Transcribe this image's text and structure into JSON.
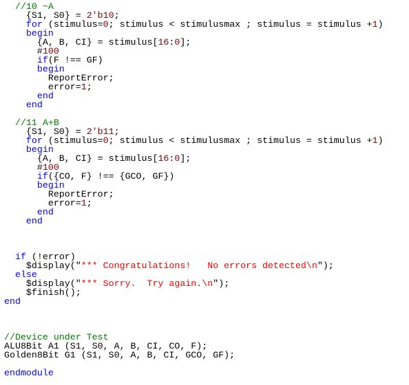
{
  "editor": {
    "language": "verilog",
    "colors": {
      "keyword": "#0000ff",
      "comment": "#008000",
      "number": "#800000",
      "string": "#ff0000",
      "plain": "#000000"
    },
    "lines": [
      {
        "indent": 2,
        "tokens": [
          {
            "t": "cm",
            "v": "//10 ~A"
          }
        ]
      },
      {
        "indent": 4,
        "tokens": [
          {
            "t": "pl",
            "v": "{S1, S0} = "
          },
          {
            "t": "num",
            "v": "2'b10"
          },
          {
            "t": "pl",
            "v": ";"
          }
        ]
      },
      {
        "indent": 4,
        "tokens": [
          {
            "t": "kw",
            "v": "for"
          },
          {
            "t": "pl",
            "v": " (stimulus="
          },
          {
            "t": "num",
            "v": "0"
          },
          {
            "t": "pl",
            "v": "; stimulus < stimulusmax ; stimulus = stimulus +"
          },
          {
            "t": "num",
            "v": "1"
          },
          {
            "t": "pl",
            "v": ")"
          }
        ]
      },
      {
        "indent": 4,
        "tokens": [
          {
            "t": "kw",
            "v": "begin"
          }
        ]
      },
      {
        "indent": 6,
        "tokens": [
          {
            "t": "pl",
            "v": "{A, B, CI} = stimulus["
          },
          {
            "t": "num",
            "v": "16"
          },
          {
            "t": "pl",
            "v": ":"
          },
          {
            "t": "num",
            "v": "0"
          },
          {
            "t": "pl",
            "v": "];"
          }
        ]
      },
      {
        "indent": 6,
        "tokens": [
          {
            "t": "pl",
            "v": "#"
          },
          {
            "t": "num",
            "v": "100"
          }
        ]
      },
      {
        "indent": 6,
        "tokens": [
          {
            "t": "kw",
            "v": "if"
          },
          {
            "t": "pl",
            "v": "(F !== GF)"
          }
        ]
      },
      {
        "indent": 6,
        "tokens": [
          {
            "t": "kw",
            "v": "begin"
          }
        ]
      },
      {
        "indent": 8,
        "tokens": [
          {
            "t": "pl",
            "v": "ReportError;"
          }
        ]
      },
      {
        "indent": 8,
        "tokens": [
          {
            "t": "pl",
            "v": "error="
          },
          {
            "t": "num",
            "v": "1"
          },
          {
            "t": "pl",
            "v": ";"
          }
        ]
      },
      {
        "indent": 6,
        "tokens": [
          {
            "t": "kw",
            "v": "end"
          }
        ]
      },
      {
        "indent": 4,
        "tokens": [
          {
            "t": "kw",
            "v": "end"
          }
        ]
      },
      {
        "indent": 0,
        "tokens": []
      },
      {
        "indent": 2,
        "tokens": [
          {
            "t": "cm",
            "v": "//11 A+B"
          }
        ]
      },
      {
        "indent": 4,
        "tokens": [
          {
            "t": "pl",
            "v": "{S1, S0} = "
          },
          {
            "t": "num",
            "v": "2'b11"
          },
          {
            "t": "pl",
            "v": ";"
          }
        ]
      },
      {
        "indent": 4,
        "tokens": [
          {
            "t": "kw",
            "v": "for"
          },
          {
            "t": "pl",
            "v": " (stimulus="
          },
          {
            "t": "num",
            "v": "0"
          },
          {
            "t": "pl",
            "v": "; stimulus < stimulusmax ; stimulus = stimulus +"
          },
          {
            "t": "num",
            "v": "1"
          },
          {
            "t": "pl",
            "v": ")"
          }
        ]
      },
      {
        "indent": 4,
        "tokens": [
          {
            "t": "kw",
            "v": "begin"
          }
        ]
      },
      {
        "indent": 6,
        "tokens": [
          {
            "t": "pl",
            "v": "{A, B, CI} = stimulus["
          },
          {
            "t": "num",
            "v": "16"
          },
          {
            "t": "pl",
            "v": ":"
          },
          {
            "t": "num",
            "v": "0"
          },
          {
            "t": "pl",
            "v": "];"
          }
        ]
      },
      {
        "indent": 6,
        "tokens": [
          {
            "t": "pl",
            "v": "#"
          },
          {
            "t": "num",
            "v": "100"
          }
        ]
      },
      {
        "indent": 6,
        "tokens": [
          {
            "t": "kw",
            "v": "if"
          },
          {
            "t": "pl",
            "v": "({CO, F} !== {GCO, GF})"
          }
        ]
      },
      {
        "indent": 6,
        "tokens": [
          {
            "t": "kw",
            "v": "begin"
          }
        ]
      },
      {
        "indent": 8,
        "tokens": [
          {
            "t": "pl",
            "v": "ReportError;"
          }
        ]
      },
      {
        "indent": 8,
        "tokens": [
          {
            "t": "pl",
            "v": "error="
          },
          {
            "t": "num",
            "v": "1"
          },
          {
            "t": "pl",
            "v": ";"
          }
        ]
      },
      {
        "indent": 6,
        "tokens": [
          {
            "t": "kw",
            "v": "end"
          }
        ]
      },
      {
        "indent": 4,
        "tokens": [
          {
            "t": "kw",
            "v": "end"
          }
        ]
      },
      {
        "indent": 0,
        "tokens": []
      },
      {
        "indent": 0,
        "tokens": []
      },
      {
        "indent": 0,
        "tokens": []
      },
      {
        "indent": 2,
        "tokens": [
          {
            "t": "kw",
            "v": "if"
          },
          {
            "t": "pl",
            "v": " (!error)"
          }
        ]
      },
      {
        "indent": 4,
        "tokens": [
          {
            "t": "pl",
            "v": "$display(\""
          },
          {
            "t": "str",
            "v": "*** Congratulations!   No errors detected\\n"
          },
          {
            "t": "pl",
            "v": "\");"
          }
        ]
      },
      {
        "indent": 2,
        "tokens": [
          {
            "t": "kw",
            "v": "else"
          }
        ]
      },
      {
        "indent": 4,
        "tokens": [
          {
            "t": "pl",
            "v": "$display(\""
          },
          {
            "t": "str",
            "v": "*** Sorry.  Try again.\\n"
          },
          {
            "t": "pl",
            "v": "\");"
          }
        ]
      },
      {
        "indent": 4,
        "tokens": [
          {
            "t": "pl",
            "v": "$finish();"
          }
        ]
      },
      {
        "indent": 0,
        "tokens": [
          {
            "t": "kw",
            "v": "end"
          }
        ]
      },
      {
        "indent": 0,
        "tokens": []
      },
      {
        "indent": 0,
        "tokens": []
      },
      {
        "indent": 0,
        "tokens": []
      },
      {
        "indent": 0,
        "tokens": [
          {
            "t": "cm",
            "v": "//Device under Test"
          }
        ]
      },
      {
        "indent": 0,
        "tokens": [
          {
            "t": "pl",
            "v": "ALU8Bit A1 (S1, S0, A, B, CI, CO, F);"
          }
        ]
      },
      {
        "indent": 0,
        "tokens": [
          {
            "t": "pl",
            "v": "Golden8Bit G1 (S1, S0, A, B, CI, GCO, GF);"
          }
        ]
      },
      {
        "indent": 0,
        "tokens": []
      },
      {
        "indent": 0,
        "tokens": [
          {
            "t": "kw",
            "v": "endmodule"
          }
        ]
      }
    ]
  }
}
